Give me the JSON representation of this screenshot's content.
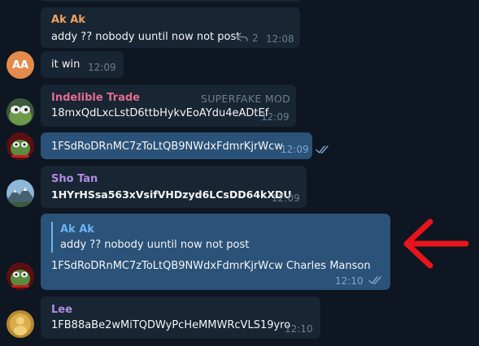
{
  "messages": [
    {
      "name": "Ak Ak",
      "name_color": "#f0a15f",
      "text": "addy ?? nobody uuntil now not post",
      "replies": "2",
      "time": "12:08"
    },
    {
      "avatar_initials": "AA",
      "text": "it win",
      "time": "12:09"
    },
    {
      "name": "Indelible Trade",
      "name_color": "#e36b90",
      "role": "SUPERFAKE MOD",
      "text": "18mxQdLxcLstD6ttbHykvEoAYdu4eADtEf",
      "time": "12:09"
    },
    {
      "text": "1FSdRoDRnMC7zToLtQB9NWdxFdmrKjrWcw",
      "time": "12:09",
      "read": true
    },
    {
      "name": "Sho Tan",
      "name_color": "#b18ce3",
      "text": "1HYrHSsa563xVsifVHDzyd6LCsDD64kXDU",
      "time": "12:09"
    },
    {
      "quote_name": "Ak Ak",
      "quote_text": "addy ?? nobody uuntil now not post",
      "text": "1FSdRoDRnMC7zToLtQB9NWdxFdmrKjrWcw Charles Manson",
      "time": "12:10",
      "read": true
    },
    {
      "name": "Lee",
      "name_color": "#b18ce3",
      "text": "1FB88aBe2wMiTQDWyPcHeMMWRcVLS19yro",
      "time": "12:10"
    }
  ],
  "colors": {
    "background": "#0e1621",
    "incoming_bubble": "#182533",
    "outgoing_bubble": "#2b5278",
    "annotation_arrow": "#e8141b"
  },
  "icons": [
    "reply-arrow-icon",
    "double-check-icon",
    "annotation-arrow"
  ]
}
